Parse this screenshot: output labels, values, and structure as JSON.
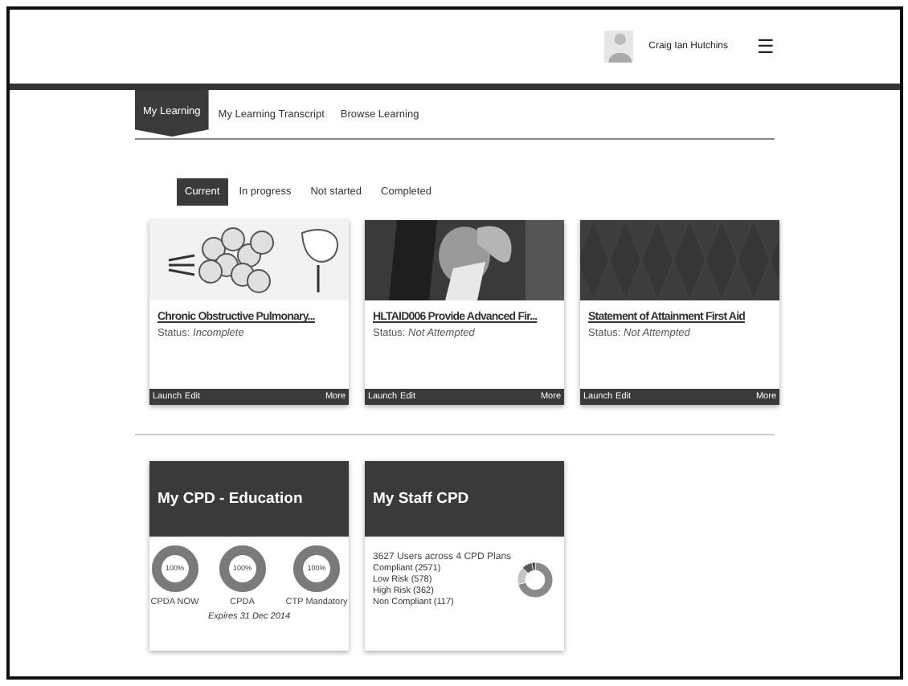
{
  "header": {
    "user_name": "Craig Ian Hutchins",
    "menu_icon": "☰"
  },
  "tabs": [
    {
      "label": "My Learning",
      "selected": true
    },
    {
      "label": "My Learning Transcript",
      "selected": false
    },
    {
      "label": "Browse Learning",
      "selected": false
    }
  ],
  "filters": [
    {
      "label": "Current",
      "selected": true
    },
    {
      "label": "In progress",
      "selected": false
    },
    {
      "label": "Not started",
      "selected": false
    },
    {
      "label": "Completed",
      "selected": false
    }
  ],
  "courses": [
    {
      "image": {
        "kind": "picture"
      },
      "title": "Chronic Obstructive Pulmonary...",
      "status_label": "Status:",
      "status": "Incomplete",
      "actions": [
        "Launch",
        "Edit"
      ],
      "more": "More"
    },
    {
      "image": {
        "kind": "picture"
      },
      "title": "HLTAID006 Provide Advanced Fir...",
      "status_label": "Status:",
      "status": "Not Attempted",
      "actions": [
        "Launch",
        "Edit"
      ],
      "more": "More"
    },
    {
      "image": {
        "kind": "picture"
      },
      "title": "Statement of Attainment First Aid",
      "status_label": "Status:",
      "status": "Not Attempted",
      "actions": [
        "Launch",
        "Edit"
      ],
      "more": "More"
    }
  ],
  "cpd_education": {
    "title": "My CPD - Education",
    "gauges": [
      {
        "reading": "100%",
        "level": 1,
        "label": "CPDA NOW"
      },
      {
        "reading": "100%",
        "level": 1,
        "label": "CPDA"
      },
      {
        "reading": "100%",
        "level": 1,
        "label": "CTP Mandatory"
      }
    ],
    "expiry": "Expires 31 Dec 2014"
  },
  "staff_cpd": {
    "title": "My Staff CPD",
    "summary": "3627 Users across 4 CPD Plans",
    "legend": [
      "Compliant (2571)",
      "Low Risk (578)",
      "High Risk (362)",
      "Non Compliant (117)"
    ]
  }
}
